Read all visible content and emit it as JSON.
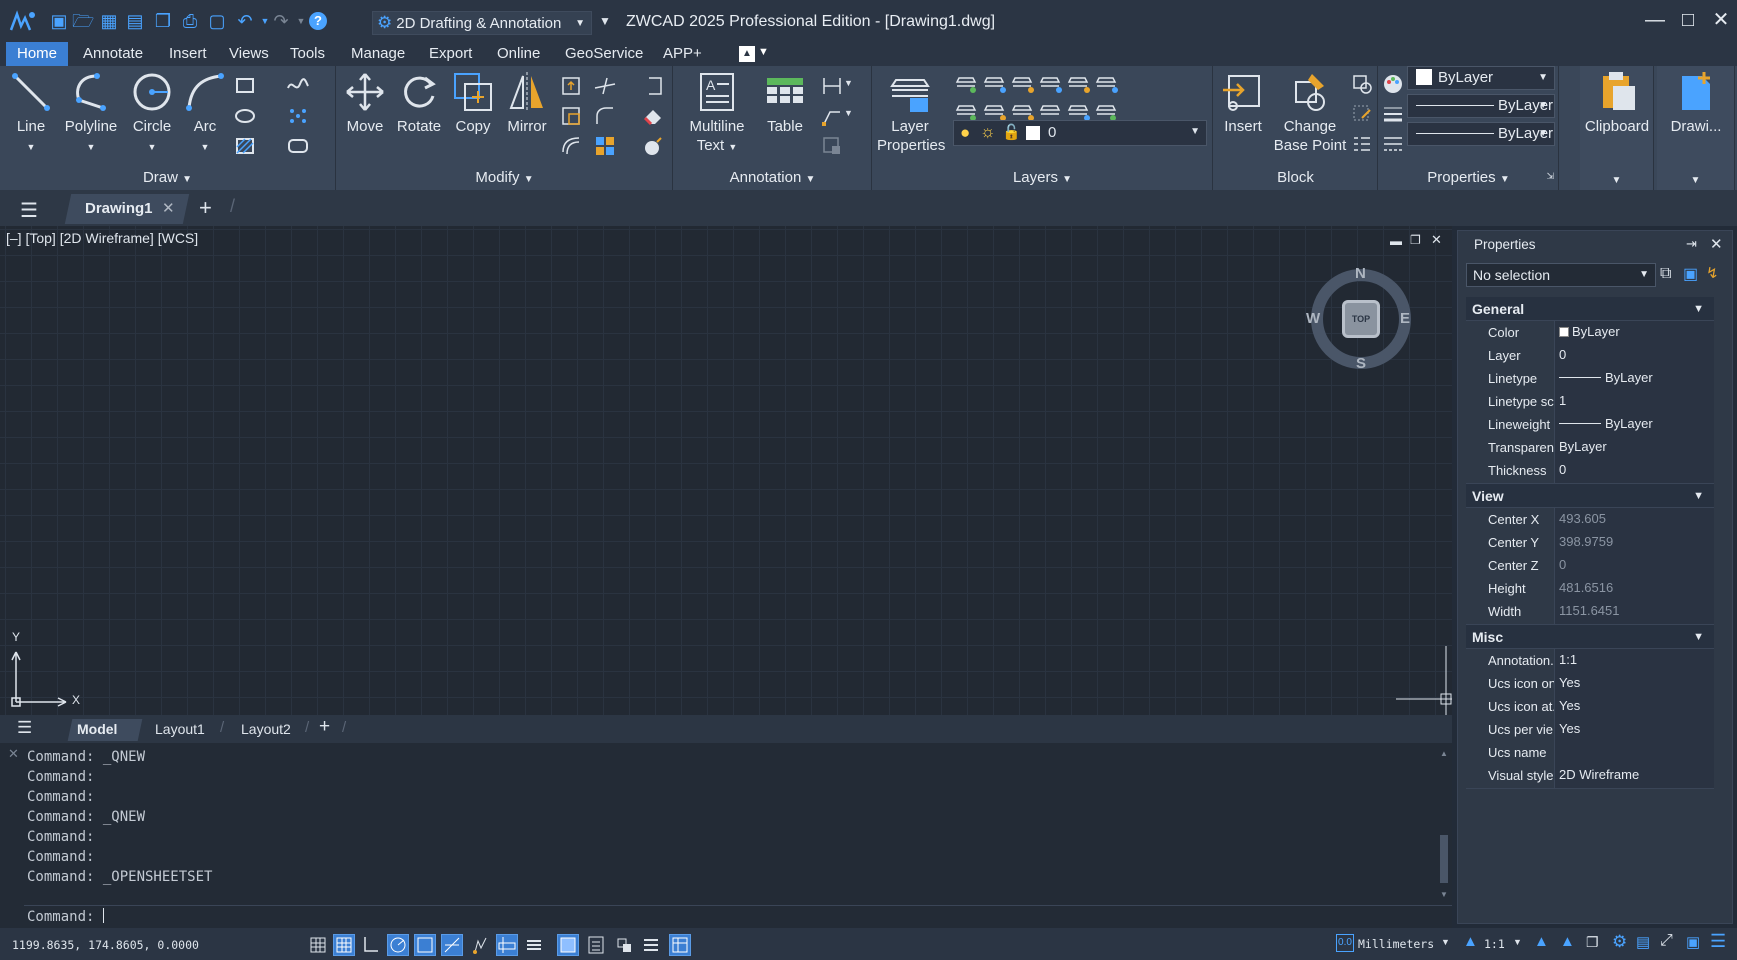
{
  "window": {
    "title": "ZWCAD 2025 Professional Edition - [Drawing1.dwg]",
    "workspace": "2D Drafting & Annotation"
  },
  "menu_tabs": [
    "Home",
    "Annotate",
    "Insert",
    "Views",
    "Tools",
    "Manage",
    "Export",
    "Online",
    "GeoService",
    "APP+"
  ],
  "ribbon": {
    "draw": {
      "title": "Draw",
      "line": "Line",
      "polyline": "Polyline",
      "circle": "Circle",
      "arc": "Arc"
    },
    "modify": {
      "title": "Modify",
      "move": "Move",
      "rotate": "Rotate",
      "copy": "Copy",
      "mirror": "Mirror"
    },
    "annotation": {
      "title": "Annotation",
      "mtext_l1": "Multiline",
      "mtext_l2": "Text",
      "table": "Table"
    },
    "layers": {
      "title": "Layers",
      "props_l1": "Layer",
      "props_l2": "Properties",
      "current_layer": "0"
    },
    "block": {
      "title": "Block",
      "insert": "Insert",
      "change_l1": "Change",
      "change_l2": "Base Point"
    },
    "properties": {
      "title": "Properties",
      "color": "ByLayer",
      "linetype": "ByLayer",
      "lineweight": "ByLayer"
    },
    "clipboard": "Clipboard",
    "drawing_util": "Drawi..."
  },
  "doc_tab": "Drawing1",
  "viewport_label": "[–] [Top] [2D Wireframe] [WCS]",
  "viewcube": {
    "n": "N",
    "s": "S",
    "e": "E",
    "w": "W",
    "face": "TOP"
  },
  "ucs": {
    "x": "X",
    "y": "Y"
  },
  "layout_tabs": [
    "Model",
    "Layout1",
    "Layout2"
  ],
  "command_history": [
    "Command: _QNEW",
    "Command:",
    "Command:",
    "Command: _QNEW",
    "Command:",
    "Command:",
    "Command: _OPENSHEETSET"
  ],
  "command_prompt": "Command:",
  "status": {
    "coords": "1199.8635, 174.8605, 0.0000",
    "units": "Millimeters",
    "scale": "1:1"
  },
  "properties_palette": {
    "title": "Properties",
    "selection": "No selection",
    "sections": {
      "general": "General",
      "view": "View",
      "misc": "Misc"
    },
    "general": [
      {
        "name": "Color",
        "value": "ByLayer"
      },
      {
        "name": "Layer",
        "value": "0"
      },
      {
        "name": "Linetype",
        "value": "ByLayer"
      },
      {
        "name": "Linetype sc...",
        "value": "1"
      },
      {
        "name": "Lineweight",
        "value": "ByLayer"
      },
      {
        "name": "Transparen...",
        "value": "ByLayer"
      },
      {
        "name": "Thickness",
        "value": "0"
      }
    ],
    "view": [
      {
        "name": "Center X",
        "value": "493.605"
      },
      {
        "name": "Center Y",
        "value": "398.9759"
      },
      {
        "name": "Center Z",
        "value": "0"
      },
      {
        "name": "Height",
        "value": "481.6516"
      },
      {
        "name": "Width",
        "value": "1151.6451"
      }
    ],
    "misc": [
      {
        "name": "Annotation...",
        "value": "1:1"
      },
      {
        "name": "Ucs icon on",
        "value": "Yes"
      },
      {
        "name": "Ucs icon at...",
        "value": "Yes"
      },
      {
        "name": "Ucs per vie...",
        "value": "Yes"
      },
      {
        "name": "Ucs name",
        "value": ""
      },
      {
        "name": "Visual style",
        "value": "2D Wireframe"
      }
    ]
  },
  "colors": {
    "accent": "#3b7fd3",
    "background": "#222b38",
    "ribbon": "#3a4759"
  }
}
